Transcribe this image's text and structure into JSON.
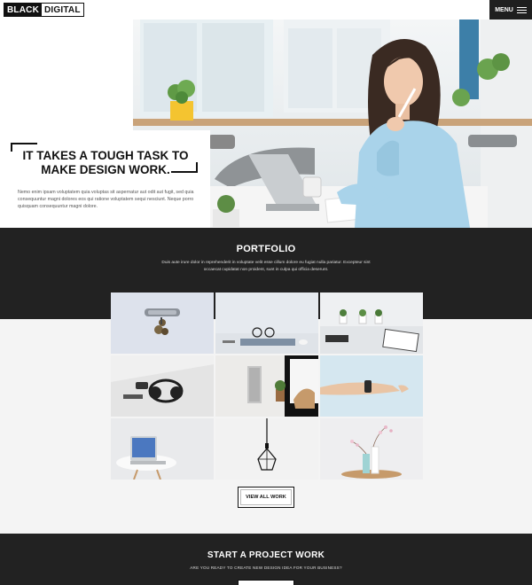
{
  "header": {
    "logo_part1": "BLACK",
    "logo_part2": "DIGITAL",
    "menu_label": "MENU"
  },
  "hero": {
    "title": "IT TAKES A TOUGH TASK TO MAKE DESIGN WORK.",
    "description": "Nemo enim ipsam voluptatem quia voluptas sit aspernatur aut odit aut fugit, sed quia consequuntur magni dolores eos qui ratione voluptatem sequi nesciunt. Neque porro quisquam consequuntur magni dolore."
  },
  "portfolio": {
    "title": "PORTFOLIO",
    "description": "Duis aute irure dolor in reprehenderit in voluptate velit esse cillum dolore eu fugiat nulla pariatur. Excepteur sint occaecat cupidatat non proident, sunt in culpa qui officia deserunt.",
    "view_all_label": "VIEW ALL WORK"
  },
  "cta": {
    "title": "START A PROJECT WORK",
    "subtitle": "ARE YOU READY TO CREATE NEW DESIGN IDEA FOR YOUR BUSINESS?"
  },
  "colors": {
    "dark": "#222222",
    "light_bg": "#f4f4f4",
    "accent": "#111111"
  }
}
